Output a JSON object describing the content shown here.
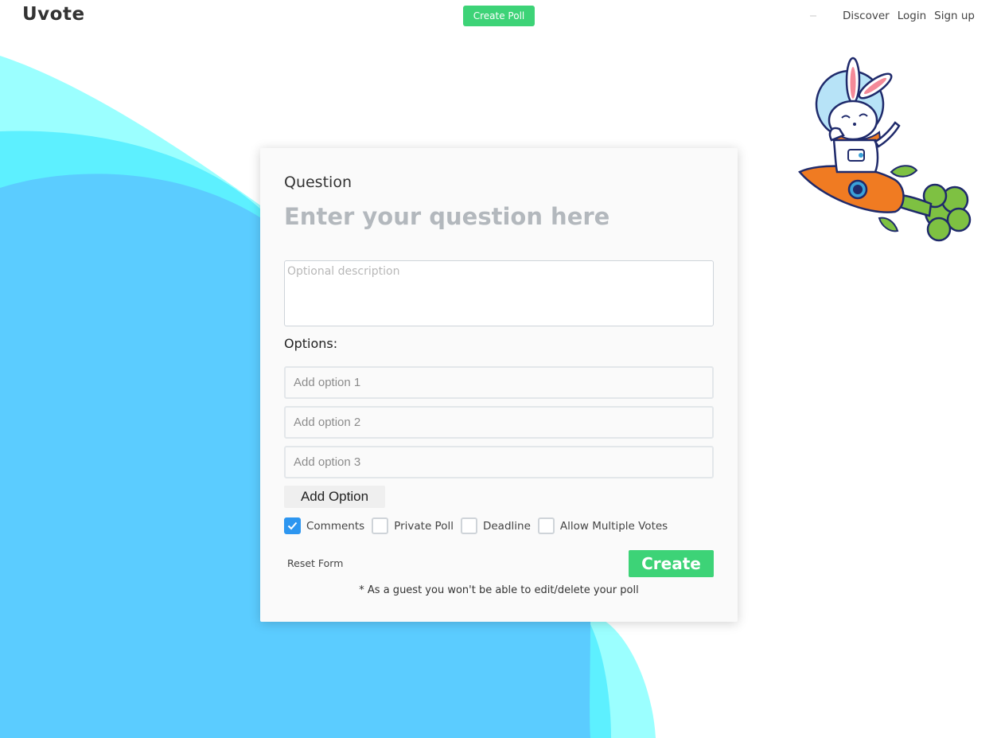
{
  "header": {
    "logo": "Uvote",
    "create_poll_label": "Create Poll",
    "nav": [
      {
        "label": "Discover"
      },
      {
        "label": "Login"
      },
      {
        "label": "Sign up"
      }
    ]
  },
  "mascot": {
    "description": "bunny-astronaut-riding-carrot-rocket",
    "icon": "bunny-rocket-illustration"
  },
  "form": {
    "question_label": "Question",
    "question_placeholder": "Enter your question here",
    "question_value": "",
    "description_placeholder": "Optional description",
    "description_value": "",
    "options_label": "Options:",
    "options": [
      {
        "placeholder": "Add option 1",
        "value": ""
      },
      {
        "placeholder": "Add option 2",
        "value": ""
      },
      {
        "placeholder": "Add option 3",
        "value": ""
      }
    ],
    "add_option_label": "Add Option",
    "settings": [
      {
        "label": "Comments",
        "checked": true
      },
      {
        "label": "Private Poll",
        "checked": false
      },
      {
        "label": "Deadline",
        "checked": false
      },
      {
        "label": "Allow Multiple Votes",
        "checked": false
      }
    ],
    "reset_label": "Reset Form",
    "create_label": "Create",
    "guest_note": "* As a guest you won't be able to edit/delete your poll"
  },
  "colors": {
    "accent_green": "#3dd377",
    "checkbox_blue": "#2d96f0",
    "wave_blue": "#5bccff",
    "wave_cyan": "#5df0ff",
    "wave_light_cyan": "#9bffff"
  }
}
